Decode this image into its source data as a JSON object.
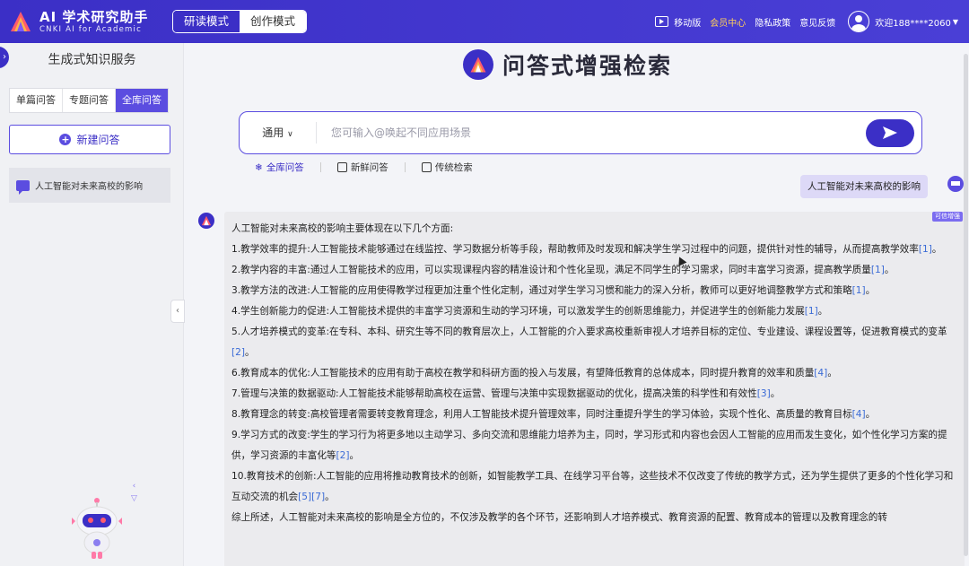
{
  "header": {
    "app_title": "AI 学术研究助手",
    "app_subtitle": "CNKI AI for Academic",
    "modes": [
      "研读模式",
      "创作模式"
    ],
    "links": {
      "mobile": "移动版",
      "member": "会员中心",
      "privacy": "隐私政策",
      "feedback": "意见反馈"
    },
    "user": "欢迎188****2060"
  },
  "sidebar": {
    "title": "生成式知识服务",
    "tabs": [
      "单篇问答",
      "专题问答",
      "全库问答"
    ],
    "new_button": "新建问答",
    "history": [
      "人工智能对未来高校的影响"
    ]
  },
  "main": {
    "hero_title": "问答式增强检索",
    "search": {
      "scope": "通用",
      "placeholder": "您可输入@唤起不同应用场景"
    },
    "search_tabs": [
      "全库问答",
      "新鲜问答",
      "传统检索"
    ],
    "user_question": "人工智能对未来高校的影响",
    "badge": "可信增强",
    "answer": {
      "intro": "人工智能对未来高校的影响主要体现在以下几个方面:",
      "items": [
        {
          "text": "1.教学效率的提升:人工智能技术能够通过在线监控、学习数据分析等手段，帮助教师及时发现和解决学生学习过程中的问题，提供针对性的辅导，从而提高教学效率",
          "refs": "[1]",
          "end": "。"
        },
        {
          "text": "2.教学内容的丰富:通过人工智能技术的应用，可以实现课程内容的精准设计和个性化呈现，满足不同学生的学习需求，同时丰富学习资源，提高教学质量",
          "refs": "[1]",
          "end": "。"
        },
        {
          "text": "3.教学方法的改进:人工智能的应用使得教学过程更加注重个性化定制，通过对学生学习习惯和能力的深入分析，教师可以更好地调整教学方式和策略",
          "refs": "[1]",
          "end": "。"
        },
        {
          "text": "4.学生创新能力的促进:人工智能技术提供的丰富学习资源和生动的学习环境，可以激发学生的创新思维能力，并促进学生的创新能力发展",
          "refs": "[1]",
          "end": "。"
        },
        {
          "text": "5.人才培养模式的变革:在专科、本科、研究生等不同的教育层次上，人工智能的介入要求高校重新审视人才培养目标的定位、专业建设、课程设置等，促进教育模式的变革",
          "refs": "[2]",
          "end": "。"
        },
        {
          "text": "6.教育成本的优化:人工智能技术的应用有助于高校在教学和科研方面的投入与发展，有望降低教育的总体成本，同时提升教育的效率和质量",
          "refs": "[4]",
          "end": "。"
        },
        {
          "text": "7.管理与决策的数据驱动:人工智能技术能够帮助高校在运营、管理与决策中实现数据驱动的优化，提高决策的科学性和有效性",
          "refs": "[3]",
          "end": "。"
        },
        {
          "text": "8.教育理念的转变:高校管理者需要转变教育理念，利用人工智能技术提升管理效率，同时注重提升学生的学习体验，实现个性化、高质量的教育目标",
          "refs": "[4]",
          "end": "。"
        },
        {
          "text": "9.学习方式的改变:学生的学习行为将更多地以主动学习、多向交流和思维能力培养为主，同时，学习形式和内容也会因人工智能的应用而发生变化，如个性化学习方案的提供，学习资源的丰富化等",
          "refs": "[2]",
          "end": "。"
        },
        {
          "text": "10.教育技术的创新:人工智能的应用将推动教育技术的创新，如智能教学工具、在线学习平台等，这些技术不仅改变了传统的教学方式，还为学生提供了更多的个性化学习和互动交流的机会",
          "refs": "[5][7]",
          "end": "。"
        }
      ],
      "summary": "综上所述，人工智能对未来高校的影响是全方位的，不仅涉及教学的各个环节，还影响到人才培养模式、教育资源的配置、教育成本的管理以及教育理念的转"
    }
  }
}
